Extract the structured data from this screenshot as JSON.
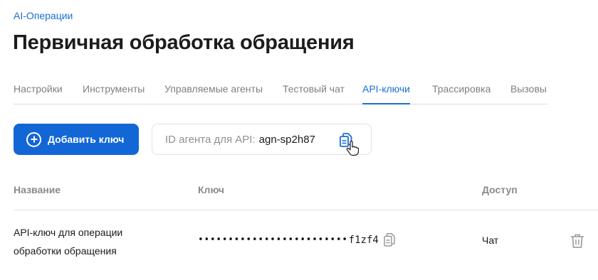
{
  "breadcrumb": "AI-Операции",
  "page_title": "Первичная обработка обращения",
  "tabs": [
    {
      "label": "Настройки",
      "active": false
    },
    {
      "label": "Инструменты",
      "active": false
    },
    {
      "label": "Управляемые агенты",
      "active": false
    },
    {
      "label": "Тестовый чат",
      "active": false
    },
    {
      "label": "API-ключи",
      "active": true
    },
    {
      "label": "Трассировка",
      "active": false
    },
    {
      "label": "Вызовы",
      "active": false
    }
  ],
  "add_button": {
    "label": "Добавить ключ",
    "icon": "plus-circle-icon"
  },
  "agent_id": {
    "label": "ID агента для API:",
    "value": "agn-sp2h87",
    "icon": "copy-icon"
  },
  "table": {
    "columns": [
      "Название",
      "Ключ",
      "Доступ"
    ],
    "rows": [
      {
        "name_line1": "API-ключ для операции",
        "name_line2": "обработки обращения",
        "key_masked": "•••••••••••••••••••••••••",
        "key_suffix": "f1zf4",
        "access": "Чат"
      }
    ]
  },
  "colors": {
    "accent": "#1366d6",
    "link": "#1a6fd6",
    "muted": "#8a8a8a"
  }
}
